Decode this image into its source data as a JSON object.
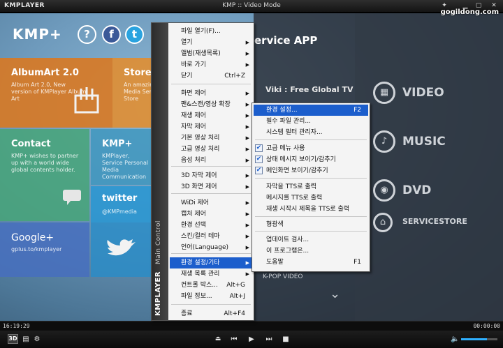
{
  "titlebar": {
    "app_name": "KMPLAYER",
    "window_title": "KMP :: Video Mode",
    "pin_icon": "pin-icon",
    "minimize_icon": "minimize-icon",
    "maximize_icon": "maximize-icon",
    "close_icon": "close-icon"
  },
  "watermark": "gogildong.com",
  "home": {
    "logo": "KMP+",
    "help_icon": "help-icon",
    "facebook_icon": "facebook-icon",
    "twitter_icon": "twitter-icon",
    "tiles": [
      {
        "title": "AlbumArt 2.0",
        "desc": "Album Art 2.0, New version of KMPlayer Album Art"
      },
      {
        "title": "Store",
        "desc": "An amazing Media Service Store"
      },
      {
        "title": "Contact",
        "desc": "KMP+ wishes to partner up with a world wide global contents holder."
      },
      {
        "title": "KMP+",
        "desc": "KMPlayer, Service Personal Media Communication"
      },
      {
        "title": "twitter",
        "desc": "@KMPmedia"
      },
      {
        "title": "Google+",
        "desc": "gplus.to/kmplayer"
      }
    ],
    "service_title": "ervice APP",
    "viki": "Viki : Free Global TV",
    "right_items": [
      "VIDEO",
      "MUSIC",
      "DVD",
      "SERVICESTORE"
    ],
    "partial_item": "K-POP VIDEO"
  },
  "main_menu": {
    "side_title": "KMPLAYER",
    "side_subtitle": "Main Control",
    "items": [
      {
        "label": "파일 열기(F)...",
        "shortcut": "",
        "arrow": ""
      },
      {
        "label": "열기",
        "shortcut": "",
        "arrow": "▶"
      },
      {
        "label": "앨범(재생목록)",
        "shortcut": "",
        "arrow": "▶"
      },
      {
        "label": "바로 가기",
        "shortcut": "",
        "arrow": "▶"
      },
      {
        "label": "닫기",
        "shortcut": "Ctrl+Z",
        "arrow": ""
      },
      {
        "label": "화면 제어",
        "shortcut": "",
        "arrow": "▶"
      },
      {
        "label": "팬&스캔/영상 확장",
        "shortcut": "",
        "arrow": "▶"
      },
      {
        "label": "재생 제어",
        "shortcut": "",
        "arrow": "▶"
      },
      {
        "label": "자막 제어",
        "shortcut": "",
        "arrow": "▶"
      },
      {
        "label": "기본 영상 처리",
        "shortcut": "",
        "arrow": "▶"
      },
      {
        "label": "고급 영상 처리",
        "shortcut": "",
        "arrow": "▶"
      },
      {
        "label": "음성 처리",
        "shortcut": "",
        "arrow": "▶"
      },
      {
        "label": "3D 자막 제어",
        "shortcut": "",
        "arrow": "▶"
      },
      {
        "label": "3D 화면 제어",
        "shortcut": "",
        "arrow": "▶"
      },
      {
        "label": "WiDi 제어",
        "shortcut": "",
        "arrow": "▶"
      },
      {
        "label": "캡처 제어",
        "shortcut": "",
        "arrow": "▶"
      },
      {
        "label": "환경 선택",
        "shortcut": "",
        "arrow": "▶"
      },
      {
        "label": "스킨/컬러 테마",
        "shortcut": "",
        "arrow": "▶"
      },
      {
        "label": "언어(Language)",
        "shortcut": "",
        "arrow": "▶"
      },
      {
        "label": "환경 설정/기타",
        "shortcut": "",
        "arrow": "▶"
      },
      {
        "label": "재생 목록 관리",
        "shortcut": "",
        "arrow": "▶"
      },
      {
        "label": "컨트롤 박스...",
        "shortcut": "Alt+G",
        "arrow": ""
      },
      {
        "label": "파일 정보...",
        "shortcut": "Alt+J",
        "arrow": ""
      },
      {
        "label": "종료",
        "shortcut": "Alt+F4",
        "arrow": ""
      }
    ]
  },
  "sub_menu": {
    "items": [
      {
        "label": "환경 설정...",
        "shortcut": "F2",
        "checked": false
      },
      {
        "label": "필수 파일 관리...",
        "shortcut": "",
        "checked": false
      },
      {
        "label": "시스템 필터 관리자...",
        "shortcut": "",
        "checked": false
      },
      {
        "label": "고급 메뉴 사용",
        "shortcut": "",
        "checked": true
      },
      {
        "label": "상태 메시지 보이기/감추기",
        "shortcut": "",
        "checked": true
      },
      {
        "label": "메인화면 보이기/감추기",
        "shortcut": "",
        "checked": true
      },
      {
        "label": "자막을 TTS로 출력",
        "shortcut": "",
        "checked": false
      },
      {
        "label": "메시지를 TTS로 출력",
        "shortcut": "",
        "checked": false
      },
      {
        "label": "재생 시작시 제목을 TTS로 출력",
        "shortcut": "",
        "checked": false
      },
      {
        "label": "형광색",
        "shortcut": "",
        "checked": false
      },
      {
        "label": "업데이트 검사...",
        "shortcut": "",
        "checked": false
      },
      {
        "label": "이 프로그램은...",
        "shortcut": "",
        "checked": false
      },
      {
        "label": "도움말",
        "shortcut": "F1",
        "checked": false
      }
    ]
  },
  "status": {
    "current_time": "16:19:29",
    "total_time": "00:00:00",
    "volume_fraction": 0.72
  },
  "controls": {
    "btn_3d": "3D",
    "prev_icon": "eject-icon",
    "rewind_icon": "previous-icon",
    "play_icon": "play-icon",
    "next_icon": "next-icon",
    "stop_icon": "stop-icon",
    "speaker_icon": "speaker-icon"
  },
  "colors": {
    "highlight": "#1c5ecc",
    "volume": "#2fb0ff"
  }
}
